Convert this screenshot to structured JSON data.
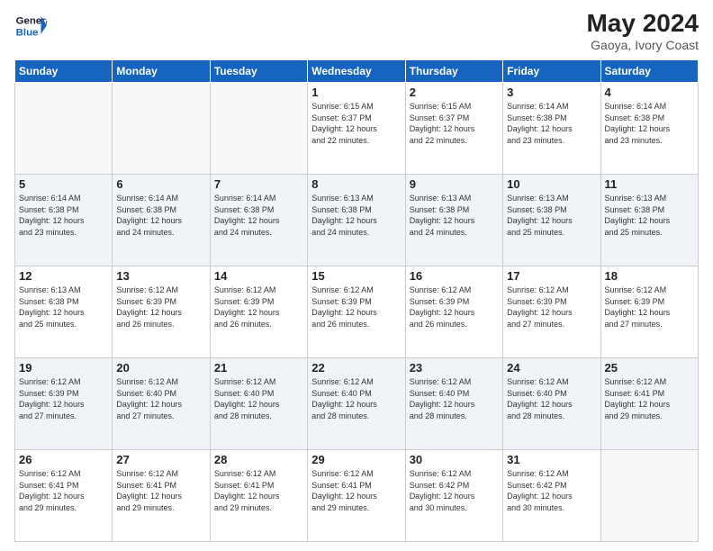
{
  "header": {
    "logo_general": "General",
    "logo_blue": "Blue",
    "month_year": "May 2024",
    "location": "Gaoya, Ivory Coast"
  },
  "weekdays": [
    "Sunday",
    "Monday",
    "Tuesday",
    "Wednesday",
    "Thursday",
    "Friday",
    "Saturday"
  ],
  "weeks": [
    [
      {
        "day": "",
        "info": ""
      },
      {
        "day": "",
        "info": ""
      },
      {
        "day": "",
        "info": ""
      },
      {
        "day": "1",
        "info": "Sunrise: 6:15 AM\nSunset: 6:37 PM\nDaylight: 12 hours\nand 22 minutes."
      },
      {
        "day": "2",
        "info": "Sunrise: 6:15 AM\nSunset: 6:37 PM\nDaylight: 12 hours\nand 22 minutes."
      },
      {
        "day": "3",
        "info": "Sunrise: 6:14 AM\nSunset: 6:38 PM\nDaylight: 12 hours\nand 23 minutes."
      },
      {
        "day": "4",
        "info": "Sunrise: 6:14 AM\nSunset: 6:38 PM\nDaylight: 12 hours\nand 23 minutes."
      }
    ],
    [
      {
        "day": "5",
        "info": "Sunrise: 6:14 AM\nSunset: 6:38 PM\nDaylight: 12 hours\nand 23 minutes."
      },
      {
        "day": "6",
        "info": "Sunrise: 6:14 AM\nSunset: 6:38 PM\nDaylight: 12 hours\nand 24 minutes."
      },
      {
        "day": "7",
        "info": "Sunrise: 6:14 AM\nSunset: 6:38 PM\nDaylight: 12 hours\nand 24 minutes."
      },
      {
        "day": "8",
        "info": "Sunrise: 6:13 AM\nSunset: 6:38 PM\nDaylight: 12 hours\nand 24 minutes."
      },
      {
        "day": "9",
        "info": "Sunrise: 6:13 AM\nSunset: 6:38 PM\nDaylight: 12 hours\nand 24 minutes."
      },
      {
        "day": "10",
        "info": "Sunrise: 6:13 AM\nSunset: 6:38 PM\nDaylight: 12 hours\nand 25 minutes."
      },
      {
        "day": "11",
        "info": "Sunrise: 6:13 AM\nSunset: 6:38 PM\nDaylight: 12 hours\nand 25 minutes."
      }
    ],
    [
      {
        "day": "12",
        "info": "Sunrise: 6:13 AM\nSunset: 6:38 PM\nDaylight: 12 hours\nand 25 minutes."
      },
      {
        "day": "13",
        "info": "Sunrise: 6:12 AM\nSunset: 6:39 PM\nDaylight: 12 hours\nand 26 minutes."
      },
      {
        "day": "14",
        "info": "Sunrise: 6:12 AM\nSunset: 6:39 PM\nDaylight: 12 hours\nand 26 minutes."
      },
      {
        "day": "15",
        "info": "Sunrise: 6:12 AM\nSunset: 6:39 PM\nDaylight: 12 hours\nand 26 minutes."
      },
      {
        "day": "16",
        "info": "Sunrise: 6:12 AM\nSunset: 6:39 PM\nDaylight: 12 hours\nand 26 minutes."
      },
      {
        "day": "17",
        "info": "Sunrise: 6:12 AM\nSunset: 6:39 PM\nDaylight: 12 hours\nand 27 minutes."
      },
      {
        "day": "18",
        "info": "Sunrise: 6:12 AM\nSunset: 6:39 PM\nDaylight: 12 hours\nand 27 minutes."
      }
    ],
    [
      {
        "day": "19",
        "info": "Sunrise: 6:12 AM\nSunset: 6:39 PM\nDaylight: 12 hours\nand 27 minutes."
      },
      {
        "day": "20",
        "info": "Sunrise: 6:12 AM\nSunset: 6:40 PM\nDaylight: 12 hours\nand 27 minutes."
      },
      {
        "day": "21",
        "info": "Sunrise: 6:12 AM\nSunset: 6:40 PM\nDaylight: 12 hours\nand 28 minutes."
      },
      {
        "day": "22",
        "info": "Sunrise: 6:12 AM\nSunset: 6:40 PM\nDaylight: 12 hours\nand 28 minutes."
      },
      {
        "day": "23",
        "info": "Sunrise: 6:12 AM\nSunset: 6:40 PM\nDaylight: 12 hours\nand 28 minutes."
      },
      {
        "day": "24",
        "info": "Sunrise: 6:12 AM\nSunset: 6:40 PM\nDaylight: 12 hours\nand 28 minutes."
      },
      {
        "day": "25",
        "info": "Sunrise: 6:12 AM\nSunset: 6:41 PM\nDaylight: 12 hours\nand 29 minutes."
      }
    ],
    [
      {
        "day": "26",
        "info": "Sunrise: 6:12 AM\nSunset: 6:41 PM\nDaylight: 12 hours\nand 29 minutes."
      },
      {
        "day": "27",
        "info": "Sunrise: 6:12 AM\nSunset: 6:41 PM\nDaylight: 12 hours\nand 29 minutes."
      },
      {
        "day": "28",
        "info": "Sunrise: 6:12 AM\nSunset: 6:41 PM\nDaylight: 12 hours\nand 29 minutes."
      },
      {
        "day": "29",
        "info": "Sunrise: 6:12 AM\nSunset: 6:41 PM\nDaylight: 12 hours\nand 29 minutes."
      },
      {
        "day": "30",
        "info": "Sunrise: 6:12 AM\nSunset: 6:42 PM\nDaylight: 12 hours\nand 30 minutes."
      },
      {
        "day": "31",
        "info": "Sunrise: 6:12 AM\nSunset: 6:42 PM\nDaylight: 12 hours\nand 30 minutes."
      },
      {
        "day": "",
        "info": ""
      }
    ]
  ]
}
